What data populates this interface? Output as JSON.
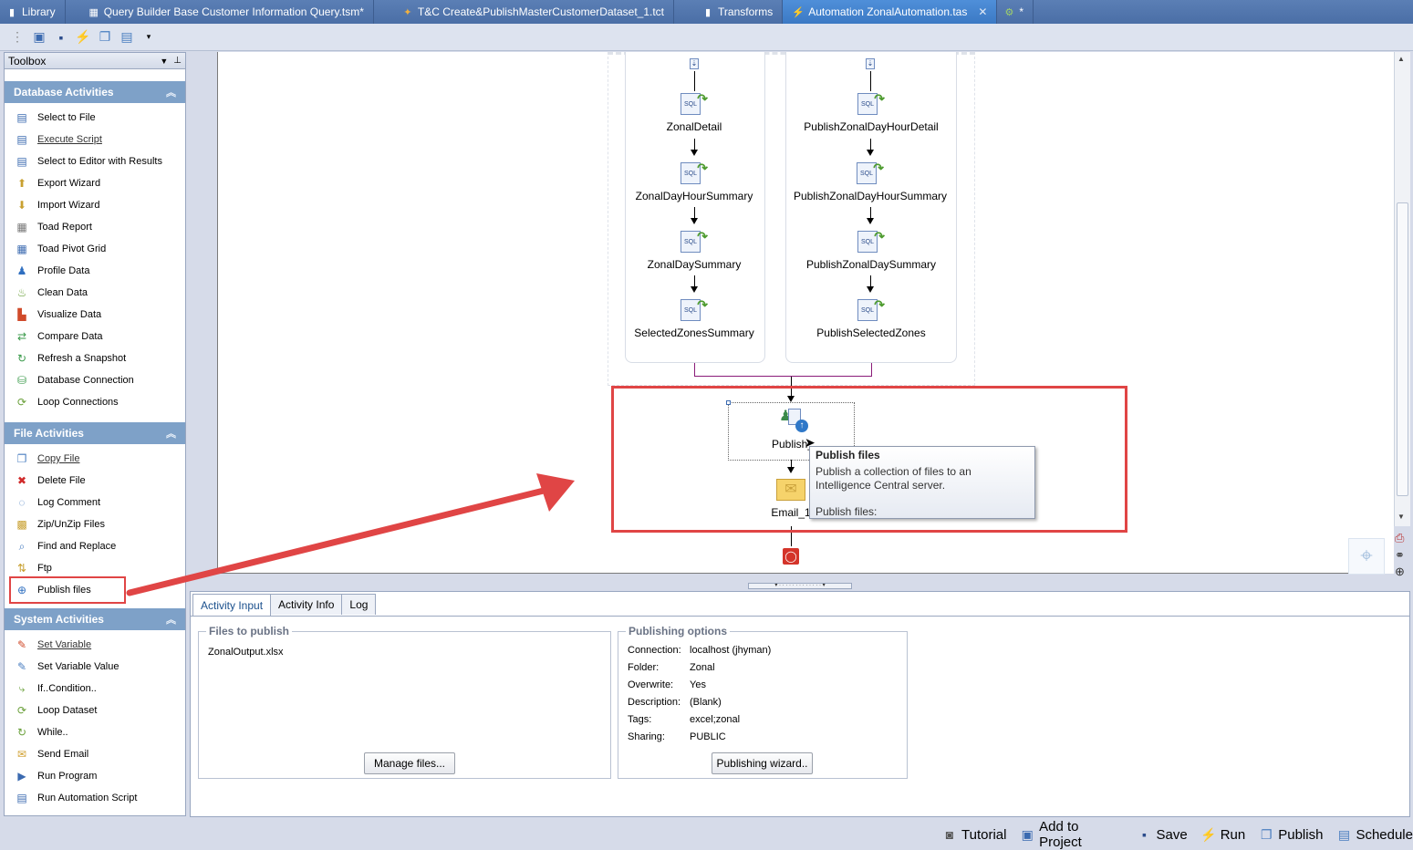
{
  "tabs": [
    {
      "label": "Library",
      "icon": "library-icon"
    },
    {
      "label": "Query Builder Base Customer Information Query.tsm*",
      "icon": "query-icon"
    },
    {
      "label": "T&C  Create&PublishMasterCustomerDataset_1.tct",
      "icon": "tct-icon"
    },
    {
      "label": "Transforms",
      "icon": "transforms-icon"
    },
    {
      "label": "Automation ZonalAutomation.tas",
      "icon": "automation-icon"
    },
    {
      "label": "*",
      "icon": "pending-icon"
    }
  ],
  "toolbox": {
    "title": "Toolbox",
    "categories": [
      {
        "label": "Database Activities",
        "items": [
          "Select to File",
          "Execute Script",
          "Select to Editor with Results",
          "Export Wizard",
          "Import Wizard",
          "Toad Report",
          "Toad Pivot Grid",
          "Profile Data",
          "Clean Data",
          "Visualize Data",
          "Compare Data",
          "Refresh a Snapshot",
          "Database Connection",
          "Loop Connections"
        ]
      },
      {
        "label": "File Activities",
        "items": [
          "Copy File",
          "Delete File",
          "Log Comment",
          "Zip/UnZip Files",
          "Find and Replace",
          "Ftp",
          "Publish files"
        ]
      },
      {
        "label": "System Activities",
        "items": [
          "Set Variable",
          "Set Variable Value",
          "If..Condition..",
          "Loop Dataset",
          "While..",
          "Send Email",
          "Run Program",
          "Run Automation Script"
        ]
      }
    ]
  },
  "workflow": {
    "left_nodes": [
      "ZonalDetail",
      "ZonalDayHourSummary",
      "ZonalDaySummary",
      "SelectedZonesSummary"
    ],
    "right_nodes": [
      "PublishZonalDayHourDetail",
      "PublishZonalDayHourSummary",
      "PublishZonalDaySummary",
      "PublishSelectedZones"
    ],
    "publish_label": "Publish_",
    "email_label": "Email_1"
  },
  "tooltip": {
    "title": "Publish files",
    "description": "Publish a collection of files to an Intelligence Central server.",
    "footer": "Publish files:"
  },
  "bottom": {
    "tabs": [
      "Activity Input",
      "Activity Info",
      "Log"
    ],
    "files_legend": "Files to publish",
    "file_item": "ZonalOutput.xlsx",
    "manage_button": "Manage files...",
    "options_legend": "Publishing options",
    "options": [
      {
        "key": "Connection:",
        "value": "localhost (jhyman)"
      },
      {
        "key": "Folder:",
        "value": "Zonal"
      },
      {
        "key": "Overwrite:",
        "value": "Yes"
      },
      {
        "key": "Description:",
        "value": "(Blank)"
      },
      {
        "key": "Tags:",
        "value": "excel;zonal"
      },
      {
        "key": "Sharing:",
        "value": "PUBLIC"
      }
    ],
    "wizard_button": "Publishing wizard.."
  },
  "actions": [
    "Tutorial",
    "Add to Project",
    "Save",
    "Run",
    "Publish",
    "Schedule"
  ],
  "colors": {
    "highlight": "#e04545",
    "category": "#7ea1c8",
    "tab_active": "#3b79c4"
  }
}
